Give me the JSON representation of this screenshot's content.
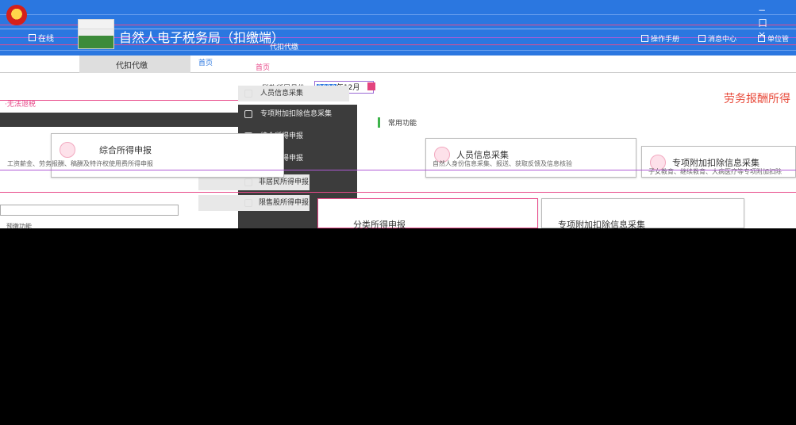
{
  "titlebar": {
    "title": "自然人电子税务局（扣缴端）",
    "subtitle": "代扣代缴",
    "online": "在线",
    "links": [
      "操作手册",
      "消息中心",
      "单位管"
    ],
    "window_controls": "− 口 ×"
  },
  "tabs": {
    "active": "代扣代缴",
    "second": "首页",
    "third": "首页"
  },
  "filter": {
    "period_label": "税款所属月份",
    "year": "2020",
    "month": "年12月"
  },
  "page": {
    "heading": "劳务报酬所得",
    "link": "·无法退税"
  },
  "menu": {
    "items": [
      {
        "label": "人员信息采集"
      },
      {
        "label": "专项附加扣除信息采集"
      },
      {
        "label": "综合所得申报"
      },
      {
        "label": "分类所得申报"
      },
      {
        "label": "非居民所得申报"
      },
      {
        "label": "限售股所得申报"
      }
    ]
  },
  "sub_tab": "常用功能",
  "cards": [
    {
      "title": "综合所得申报",
      "desc": "工资薪金、劳务报酬、稿酬及特许权使用费所得申报"
    },
    {
      "title": "人员信息采集",
      "desc": "自然人身份信息采集、报送、获取反馈及信息核验"
    },
    {
      "title": "专项附加扣除信息采集",
      "desc": "子女教育、继续教育、大病医疗等专项附加扣除"
    },
    {
      "title": "分类所得申报",
      "desc": ""
    },
    {
      "title": "专项附加扣除信息采集",
      "desc": ""
    }
  ],
  "bottom_label": "预缴功能",
  "colors": {
    "titlebar": "#2b77e0",
    "accent_pink": "#e84a8a",
    "heading_red": "#e84a3a"
  }
}
